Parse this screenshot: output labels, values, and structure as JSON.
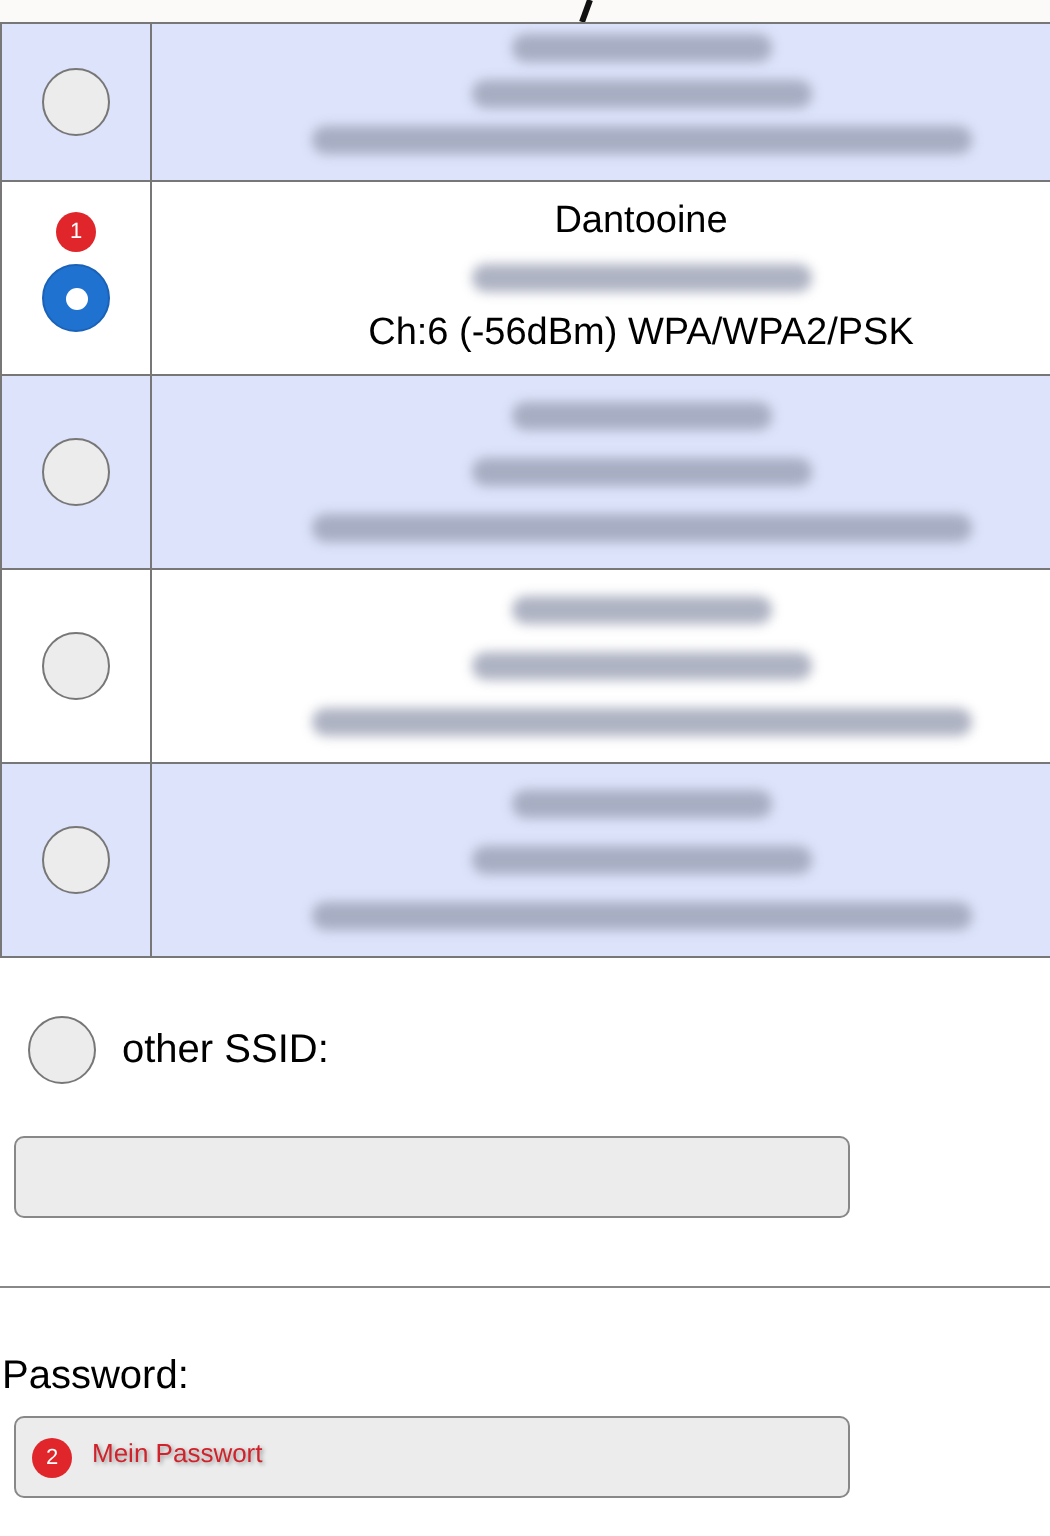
{
  "networks": [
    {
      "selected": false,
      "cut": true,
      "lines": [
        {
          "kind": "blurred"
        },
        {
          "kind": "blurred"
        },
        {
          "kind": "blurred"
        }
      ]
    },
    {
      "selected": true,
      "badge": "1",
      "lines": [
        {
          "kind": "text",
          "text": "Dantooine"
        },
        {
          "kind": "blurred"
        },
        {
          "kind": "text",
          "text": "Ch:6 (-56dBm) WPA/WPA2/PSK"
        }
      ]
    },
    {
      "selected": false,
      "lines": [
        {
          "kind": "blurred"
        },
        {
          "kind": "blurred"
        },
        {
          "kind": "blurred"
        }
      ]
    },
    {
      "selected": false,
      "lines": [
        {
          "kind": "blurred"
        },
        {
          "kind": "blurred"
        },
        {
          "kind": "blurred"
        }
      ]
    },
    {
      "selected": false,
      "lines": [
        {
          "kind": "blurred"
        },
        {
          "kind": "blurred"
        },
        {
          "kind": "blurred"
        }
      ]
    }
  ],
  "other_ssid": {
    "label": "other SSID:",
    "selected": false
  },
  "password": {
    "label": "Password:",
    "badge": "2",
    "value": "Mein Passwort"
  }
}
